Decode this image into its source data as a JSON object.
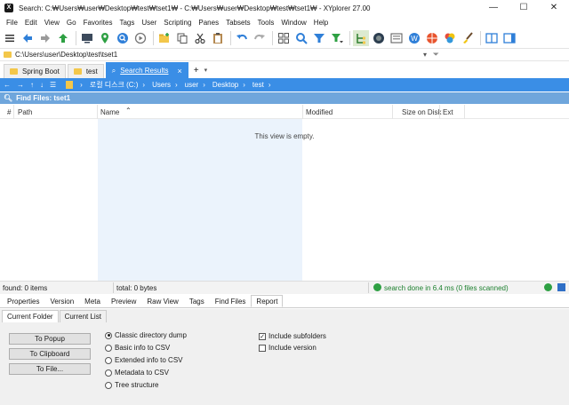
{
  "window": {
    "title": "Search: C:₩Users₩user₩Desktop₩test₩tset1₩ - C:₩Users₩user₩Desktop₩test₩tset1₩ - XYplorer 27.00",
    "minimize": "—",
    "maximize": "☐",
    "close": "✕"
  },
  "menu": [
    "File",
    "Edit",
    "View",
    "Go",
    "Favorites",
    "Tags",
    "User",
    "Scripting",
    "Panes",
    "Tabsets",
    "Tools",
    "Window",
    "Help"
  ],
  "toolbar": {
    "icons": [
      "menu-icon",
      "back-icon",
      "forward-icon",
      "up-icon",
      "computer-icon",
      "location-pin-icon",
      "find-icon",
      "play-icon",
      "new-folder-icon",
      "copy-icon",
      "cut-icon",
      "paste-icon",
      "undo-icon",
      "redo-icon",
      "grid-icon",
      "zoom-icon",
      "filter-icon",
      "filter-dropdown-icon",
      "tree-icon",
      "catalog-icon",
      "panel-icon",
      "web-icon",
      "globe-icon",
      "color-icon",
      "brush-icon",
      "dual-pane-icon",
      "sidebar-icon"
    ]
  },
  "address": {
    "path": "C:\\Users\\user\\Desktop\\test\\tset1"
  },
  "tabs": [
    {
      "label": "Spring Boot",
      "active": false
    },
    {
      "label": "test",
      "active": false
    },
    {
      "label": "Search Results",
      "active": true
    }
  ],
  "breadcrumb": {
    "items": [
      "로컬 디스크 (C:)",
      "Users",
      "user",
      "Desktop",
      "test"
    ]
  },
  "find_header": {
    "label": "Find Files: tset1"
  },
  "columns": {
    "num": "#",
    "path": "Path",
    "name": "Name",
    "modified": "Modified",
    "size": "Size on Disk",
    "ext": "Ext"
  },
  "list": {
    "empty_text": "This view is empty."
  },
  "status": {
    "found": "found: 0 items",
    "total": "total: 0 bytes",
    "done": "search done in 6.4 ms (0 files scanned)"
  },
  "info_tabs": [
    "Properties",
    "Version",
    "Meta",
    "Preview",
    "Raw View",
    "Tags",
    "Find Files",
    "Report"
  ],
  "info_active": "Report",
  "sub_tabs": [
    "Current Folder",
    "Current List"
  ],
  "report": {
    "buttons": [
      "To Popup",
      "To Clipboard",
      "To File..."
    ],
    "radios": [
      {
        "label": "Classic directory dump",
        "checked": true
      },
      {
        "label": "Basic info to CSV",
        "checked": false
      },
      {
        "label": "Extended info to CSV",
        "checked": false
      },
      {
        "label": "Metadata to CSV",
        "checked": false
      },
      {
        "label": "Tree structure",
        "checked": false
      }
    ],
    "checks": [
      {
        "label": "Include subfolders",
        "checked": true
      },
      {
        "label": "Include version",
        "checked": false
      }
    ]
  },
  "colors": {
    "accent": "#3a8ee6",
    "find_header": "#6fa6dc",
    "status_ok": "#1b7f2d"
  }
}
